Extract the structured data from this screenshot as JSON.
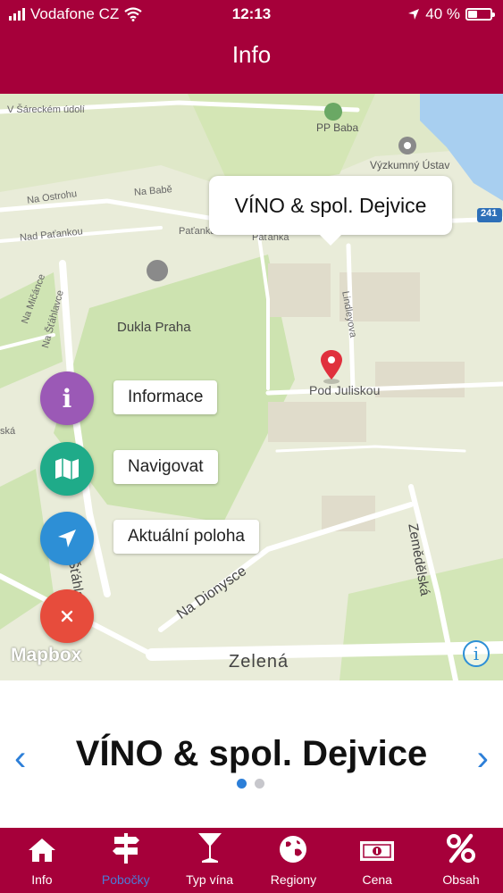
{
  "status": {
    "carrier": "Vodafone CZ",
    "time": "12:13",
    "battery": "40 %",
    "battery_level": 0.4
  },
  "header": {
    "title": "Info"
  },
  "map": {
    "callout": "VÍNO & spol. Dejvice",
    "labels": {
      "pp_baba": "PP Baba",
      "vyzkumny": "Výzkumný Ústav",
      "dukla": "Dukla Praha",
      "na_ostrohu": "Na Ostrohu",
      "na_babe": "Na Babě",
      "nad_patankou": "Nad Paťankou",
      "patanka": "Paťanka",
      "patanka2": "Paťanka",
      "na_salavce": "Na Šťáhlavce",
      "na_micanke": "Na Mičánce",
      "ska": "ská",
      "lindleyova": "Lindleyova",
      "pod_juliskou": "Pod Juliskou",
      "na_dionysce": "Na Dionysce",
      "zemedelska": "Zemědělská",
      "zelena": "Zelená",
      "road_241": "241",
      "na_slance": "na Šťáhlavce",
      "ce": "ce",
      "top_street": "V Šáreckém údolí"
    },
    "actions": {
      "info": "Informace",
      "navigate": "Navigovat",
      "location": "Aktuální poloha"
    },
    "attribution": "Mapbox",
    "info_glyph": "i"
  },
  "branch": {
    "name": "VÍNO & spol. Dejvice",
    "prev": "‹",
    "next": "›"
  },
  "tabs": [
    {
      "label": "Info",
      "icon": "home-icon"
    },
    {
      "label": "Pobočky",
      "icon": "signpost-icon"
    },
    {
      "label": "Typ vína",
      "icon": "wine-glass-icon"
    },
    {
      "label": "Regiony",
      "icon": "globe-icon"
    },
    {
      "label": "Cena",
      "icon": "banknote-icon"
    },
    {
      "label": "Obsah",
      "icon": "percent-icon"
    }
  ],
  "colors": {
    "brand": "#a6003a",
    "info": "#9b59b6",
    "navigate": "#1fab89",
    "location": "#2d8fd6",
    "close": "#e74c3c",
    "accent": "#2d7fd8"
  }
}
